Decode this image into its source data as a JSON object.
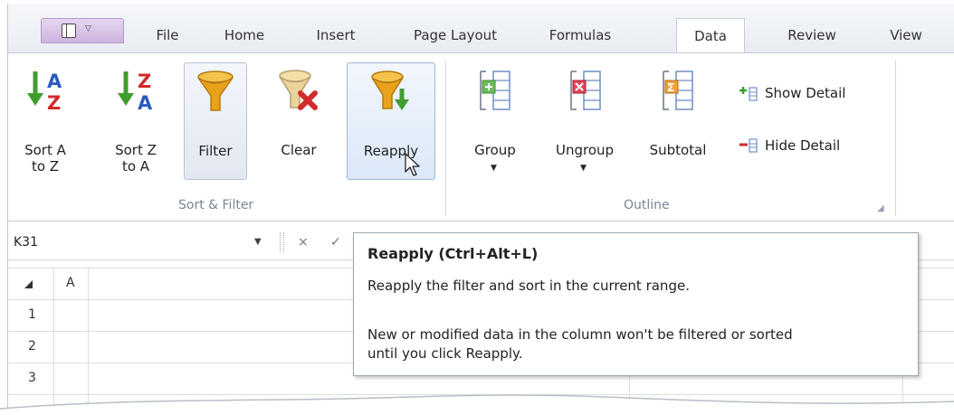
{
  "tabs": [
    "File",
    "Home",
    "Insert",
    "Page Layout",
    "Formulas",
    "Data",
    "Review",
    "View"
  ],
  "active_tab": "Data",
  "ribbon": {
    "sort_filter": {
      "sort_az": "Sort A\nto Z",
      "sort_za": "Sort Z\nto A",
      "filter": "Filter",
      "clear": "Clear",
      "reapply": "Reapply",
      "group_label": "Sort & Filter"
    },
    "outline": {
      "group": "Group",
      "ungroup": "Ungroup",
      "subtotal": "Subtotal",
      "show_detail": "Show Detail",
      "hide_detail": "Hide Detail",
      "group_label": "Outline"
    }
  },
  "formula_bar": {
    "name_box": "K31",
    "cancel": "×",
    "enter": "✓"
  },
  "sheet": {
    "column_header": "A",
    "rows": [
      "1",
      "2",
      "3"
    ]
  },
  "tooltip": {
    "title": "Reapply (Ctrl+Alt+L)",
    "line1": "Reapply the filter and sort in the current range.",
    "line2": "New or modified data in the column won't be filtered or sorted",
    "line3": "until you click Reapply."
  },
  "colors": {
    "accent_green": "#3f9d2e",
    "accent_red": "#d12b2b",
    "funnel_orange": "#e8a21c"
  }
}
